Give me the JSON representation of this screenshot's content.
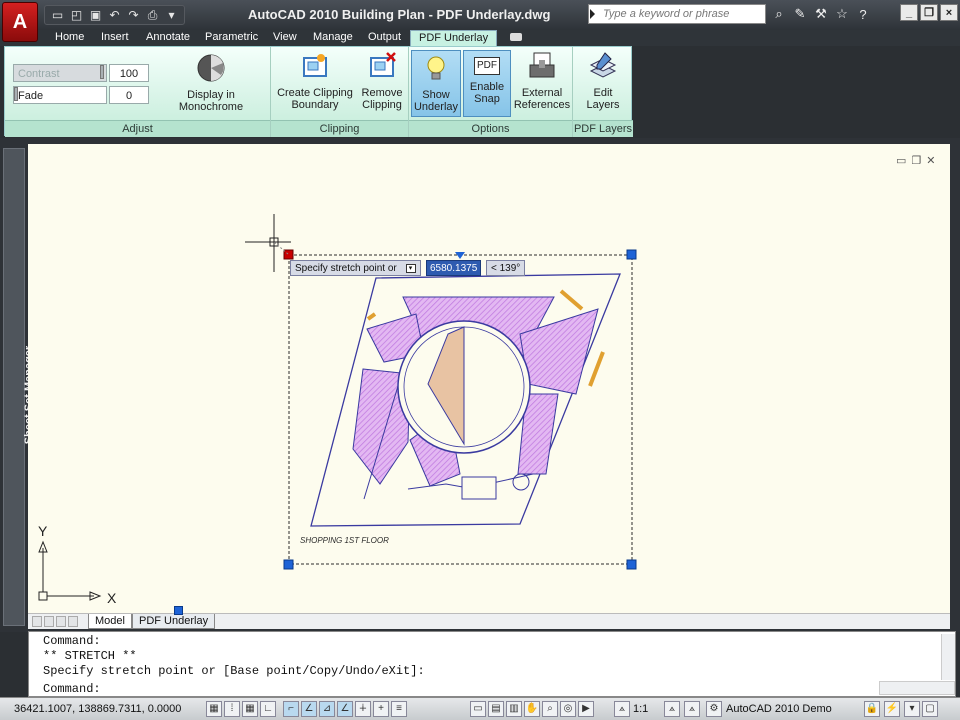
{
  "app": {
    "title": "AutoCAD 2010    Building Plan - PDF Underlay.dwg",
    "app_button_glyph": "A"
  },
  "search": {
    "placeholder": "Type a keyword or phrase"
  },
  "ribbon_tabs": [
    {
      "label": "Home"
    },
    {
      "label": "Insert"
    },
    {
      "label": "Annotate"
    },
    {
      "label": "Parametric"
    },
    {
      "label": "View"
    },
    {
      "label": "Manage"
    },
    {
      "label": "Output"
    },
    {
      "label": "PDF Underlay",
      "active": true
    }
  ],
  "adjust": {
    "contrast_label": "Contrast",
    "contrast_value": "100",
    "fade_label": "Fade",
    "fade_value": "0",
    "monochrome_label": "Display in Monochrome",
    "panel_title": "Adjust"
  },
  "clipping": {
    "create_label_1": "Create Clipping",
    "create_label_2": "Boundary",
    "remove_label_1": "Remove",
    "remove_label_2": "Clipping",
    "panel_title": "Clipping"
  },
  "options": {
    "show_label_1": "Show",
    "show_label_2": "Underlay",
    "snap_label_1": "Enable",
    "snap_label_2": "Snap",
    "snap_icon_text": "PDF",
    "xref_label_1": "External",
    "xref_label_2": "References",
    "panel_title": "Options"
  },
  "pdf_layers": {
    "edit_label_1": "Edit",
    "edit_label_2": "Layers",
    "panel_title": "PDF Layers"
  },
  "sheet_set_manager": {
    "label": "Sheet Set Manager"
  },
  "drawing": {
    "plan_caption": "SHOPPING 1ST FLOOR",
    "tooltip_prompt": "Specify stretch point or",
    "tooltip_value": "6580.1375",
    "tooltip_angle": "< 139°",
    "axis_y": "Y",
    "axis_x": "X"
  },
  "layout_tabs": [
    {
      "label": "Model"
    },
    {
      "label": "PDF Underlay"
    }
  ],
  "command_line": {
    "lines": [
      "Command:",
      "** STRETCH **",
      "Specify stretch point or [Base point/Copy/Undo/eXit]:",
      "Command:"
    ]
  },
  "status": {
    "coordinates": "36421.1007, 138869.7311, 0.0000",
    "annotation_scale": "1:1",
    "workspace": "AutoCAD 2010 Demo"
  },
  "colors": {
    "ribbon_bg": "#c4ecd9",
    "canvas_bg": "#fdfcee",
    "hatch": "#d39ce8",
    "grip": "#1e63d6",
    "plan_line": "#2b2ba8"
  }
}
